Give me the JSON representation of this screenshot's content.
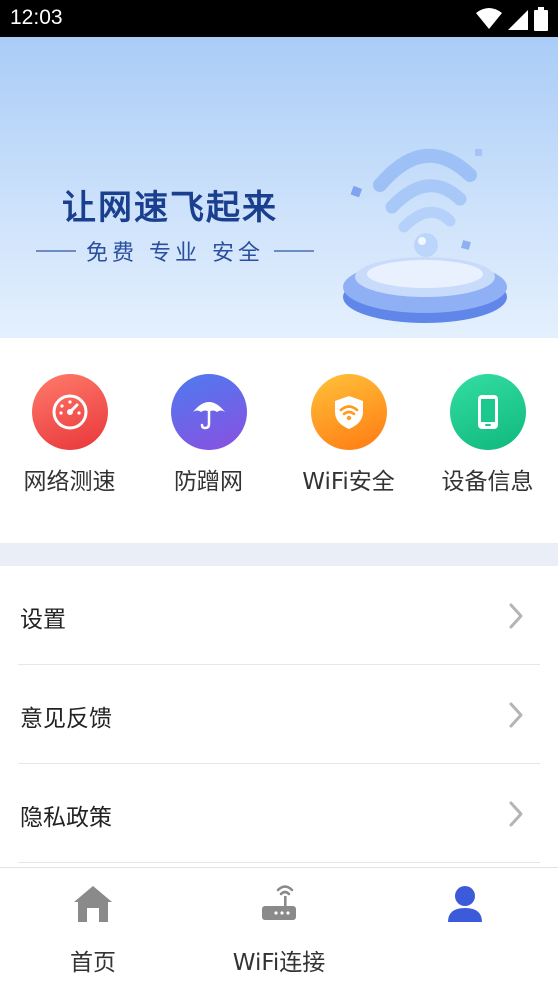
{
  "status_bar": {
    "time": "12:03",
    "icons": [
      "wifi-icon",
      "signal-icon",
      "battery-icon"
    ]
  },
  "banner": {
    "title": "让网速飞起来",
    "subtitle": "免费 专业 安全"
  },
  "features": [
    {
      "label": "网络测速",
      "icon": "speedometer-icon",
      "color": "#ef4b4b"
    },
    {
      "label": "防蹭网",
      "icon": "umbrella-icon",
      "color": "#6f5ce6"
    },
    {
      "label": "WiFi安全",
      "icon": "wifi-shield-icon",
      "color": "#ff9a1f"
    },
    {
      "label": "设备信息",
      "icon": "phone-icon",
      "color": "#17c98e"
    }
  ],
  "menu": {
    "items": [
      {
        "label": "设置"
      },
      {
        "label": "意见反馈"
      },
      {
        "label": "隐私政策"
      }
    ]
  },
  "bottom_nav": {
    "items": [
      {
        "label": "首页",
        "icon": "home-icon"
      },
      {
        "label": "WiFi连接",
        "icon": "router-icon"
      },
      {
        "label": "",
        "icon": "user-icon",
        "active": true
      }
    ],
    "active_color": "#3b5bdb",
    "inactive_color": "#8a8a8a"
  }
}
